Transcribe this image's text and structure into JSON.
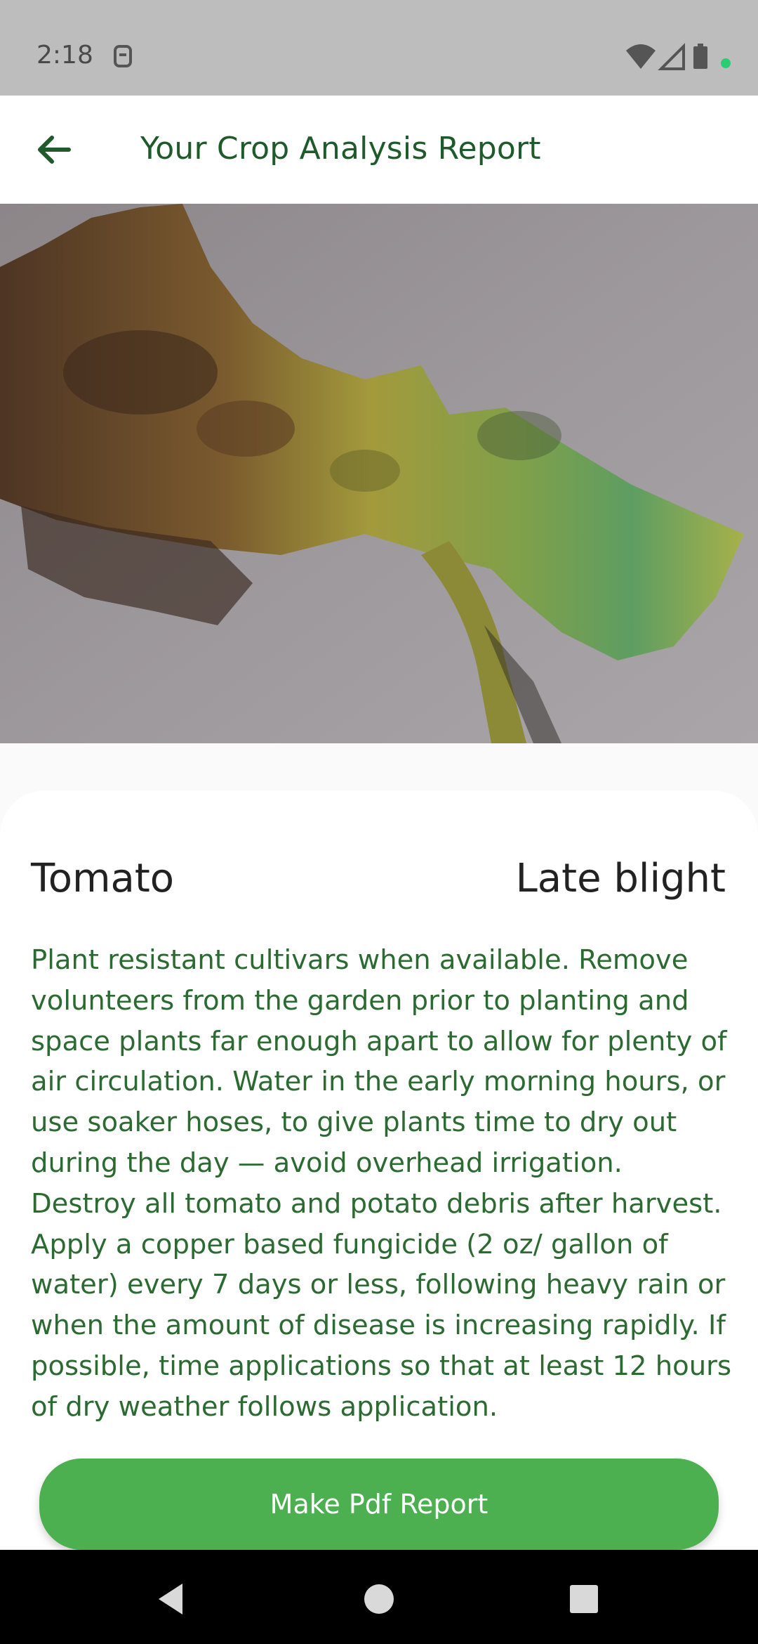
{
  "status_bar": {
    "time": "2:18",
    "icons": [
      "sim-card-icon",
      "wifi-icon",
      "signal-icon",
      "battery-icon",
      "notification-dot-icon"
    ]
  },
  "app_bar": {
    "title": "Your Crop Analysis Report",
    "back_icon": "arrow-left-icon"
  },
  "result": {
    "crop": "Tomato",
    "disease": "Late blight",
    "treatment": "Plant resistant cultivars when available. Remove volunteers from the garden prior to planting and space plants far enough apart to allow for plenty of air circulation. Water in the early morning hours, or use soaker hoses, to give plants time to dry out during the day — avoid overhead irrigation. Destroy all tomato and potato debris after harvest. Apply a copper based fungicide (2 oz/ gallon of water) every 7 days or less, following heavy rain or when the amount of disease is increasing rapidly. If possible, time applications so that at least 12 hours of dry weather follows application."
  },
  "actions": {
    "pdf_label": "Make Pdf Report"
  },
  "nav_bar": {
    "icons": [
      "back-triangle-icon",
      "home-circle-icon",
      "recents-square-icon"
    ]
  },
  "colors": {
    "accent_green": "#4caf50",
    "title_green": "#1e5a2a",
    "text_green": "#2b6a31",
    "status_bar_bg": "#bdbdbd"
  }
}
